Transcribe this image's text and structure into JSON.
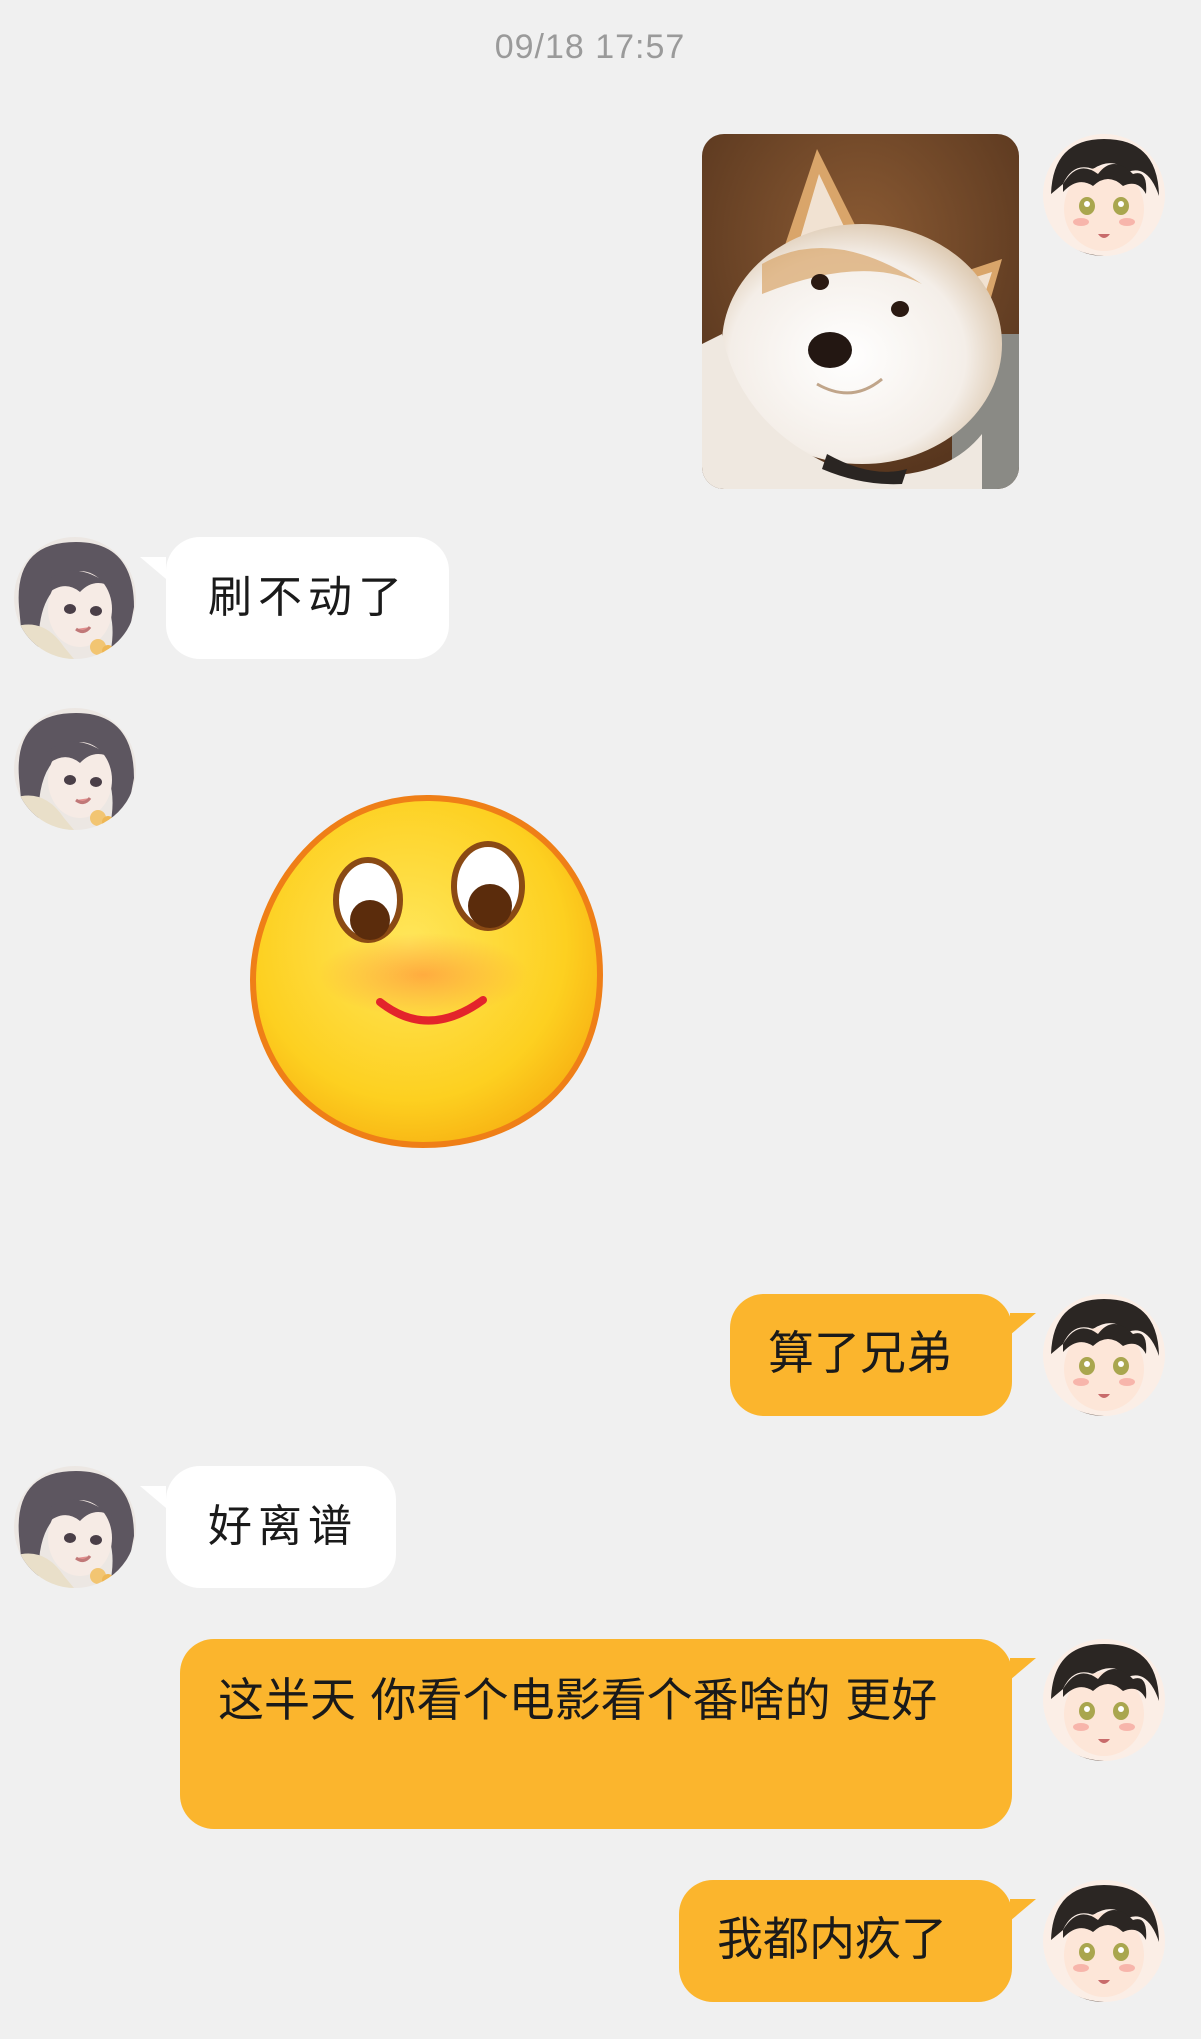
{
  "timestamp": "09/18 17:57",
  "avatars": {
    "me": "anime-boy-avatar",
    "friend": "anime-girl-avatar"
  },
  "messages": [
    {
      "from": "me",
      "type": "image",
      "content": "shiba-inu-photo"
    },
    {
      "from": "friend",
      "type": "text",
      "text": "刷不动了"
    },
    {
      "from": "friend",
      "type": "sticker",
      "content": "smiling-face-sticker"
    },
    {
      "from": "me",
      "type": "text",
      "text": "算了兄弟"
    },
    {
      "from": "friend",
      "type": "text",
      "text": "好离谱"
    },
    {
      "from": "me",
      "type": "text",
      "text": "这半天 你看个电影看个番啥的 更好"
    },
    {
      "from": "me",
      "type": "text",
      "text": "我都内疚了"
    }
  ],
  "colors": {
    "background": "#f0f0f0",
    "my_bubble": "#fbb52d",
    "friend_bubble": "#ffffff",
    "timestamp": "#9a9a9a"
  }
}
